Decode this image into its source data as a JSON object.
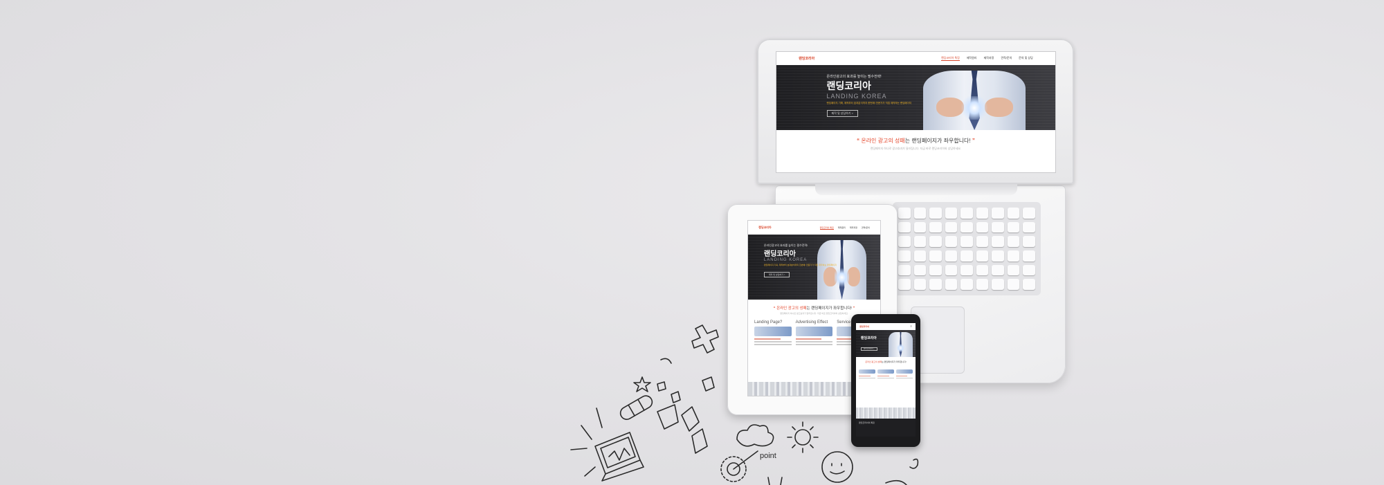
{
  "site": {
    "logo": "랜딩코리아",
    "logo_sub": "LANDING KOREA",
    "menu": [
      "랜딩코리아 특징",
      "제작원리",
      "제작과정",
      "견적/문의",
      "문의 및 상담"
    ],
    "menu_active_index": 0,
    "hero": {
      "kicker": "온라인광고의 효과를 높이는 필수전략!",
      "title": "랜딩코리아",
      "subtitle": "LANDING KOREA",
      "desc": "랜딩페이지 기획, 제작부터 효과분석까지 한번에! 전문가가 직접 제작하는 랜딩페이지",
      "button": "제작 및 상담하기 >"
    },
    "tagline": {
      "open_quote": "“",
      "accent": "온라인 광고의 성패",
      "rest": "는 랜딩페이지가 좌우합니다!",
      "close_quote": "”"
    },
    "tagline_sub": "랜딩페이지 하나로 광고효과가 달라집니다. 지금 바로 랜딩코리아와 상담하세요.",
    "features": [
      {
        "title": "Landing Page?",
        "heading": "랜딩페이지란?"
      },
      {
        "title": "Advertising Effect",
        "heading": "광고의 효과를 높이는 랜딩"
      },
      {
        "title": "Service Mind",
        "heading": "랜딩코리아의 서비스"
      }
    ],
    "footer": "랜딩코리아의 특징"
  },
  "doodles": {
    "point_label": "point"
  },
  "colors": {
    "accent": "#d9462b",
    "hero_bg": "#2b2b2f",
    "device_white": "#f4f4f5",
    "phone_black": "#1b1b1d"
  }
}
